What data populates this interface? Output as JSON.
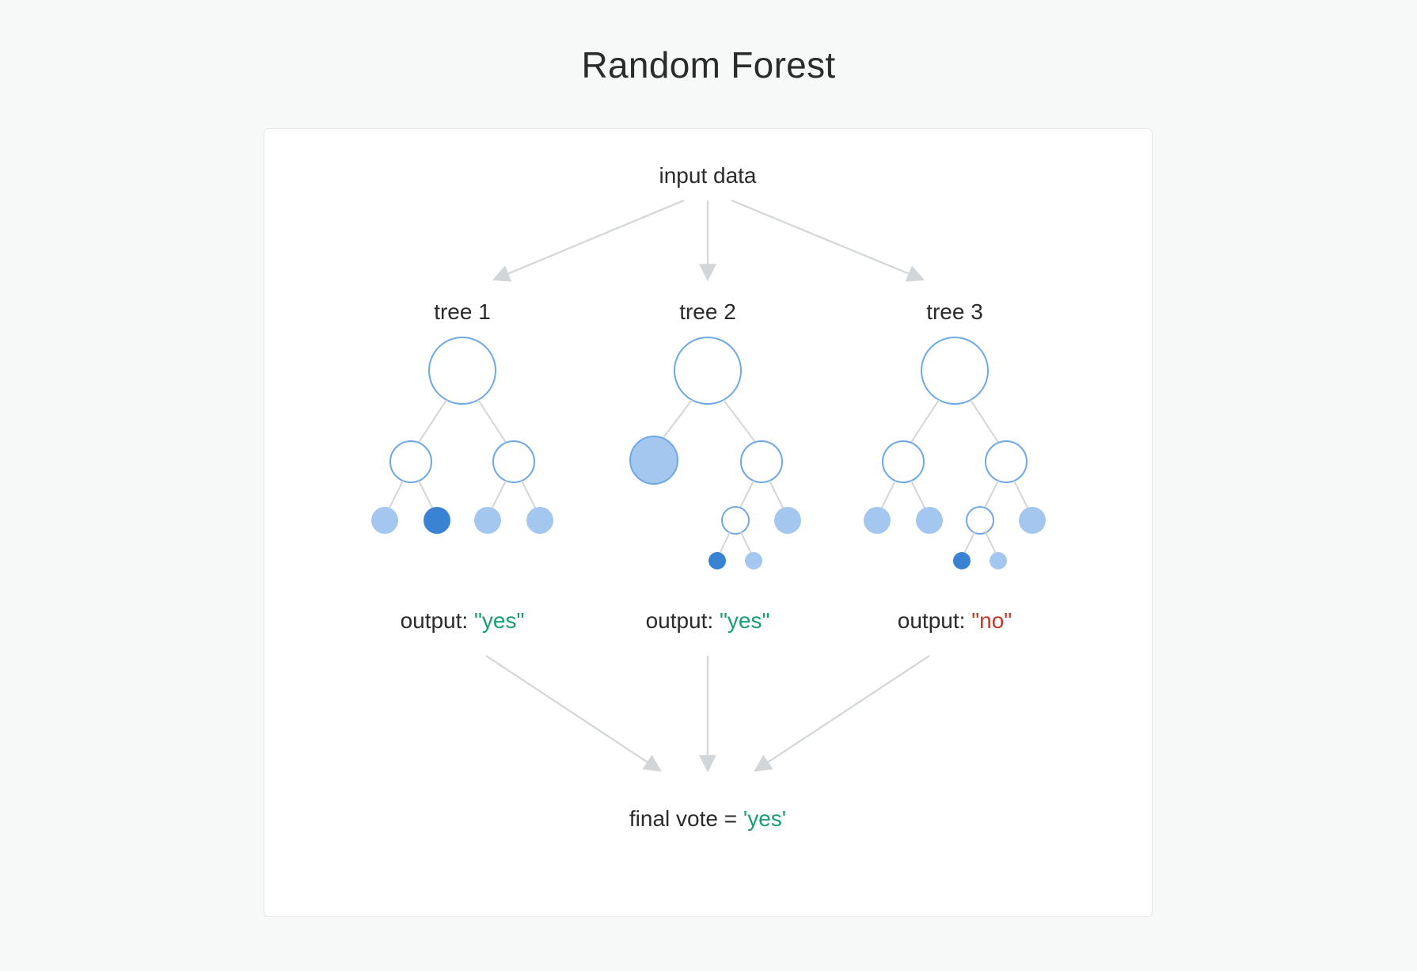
{
  "title": "Random Forest",
  "input_label": "input data",
  "trees": [
    {
      "label": "tree 1",
      "output_prefix": "output: ",
      "output_value": "\"yes\"",
      "output_class": "yes"
    },
    {
      "label": "tree 2",
      "output_prefix": "output: ",
      "output_value": "\"yes\"",
      "output_class": "yes"
    },
    {
      "label": "tree 3",
      "output_prefix": "output: ",
      "output_value": "\"no\"",
      "output_class": "no"
    }
  ],
  "final_prefix": "final vote = ",
  "final_value": "'yes'",
  "final_class": "yes",
  "colors": {
    "page_bg": "#f7f8f8",
    "card_bg": "#ffffff",
    "card_border": "#e3e5e6",
    "text": "#2b2b2b",
    "arrow": "#d3d6d9",
    "node_stroke": "#6ea8e6",
    "node_fill_light": "#a3c7ef",
    "node_fill_dark": "#3a82d2",
    "yes": "#1a9d72",
    "no": "#c0392b"
  }
}
